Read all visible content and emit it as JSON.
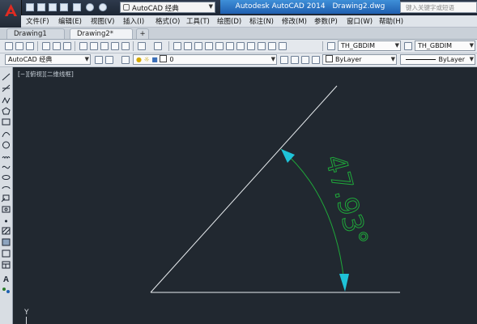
{
  "title_bar": {
    "workspace": "AutoCAD 经典",
    "app_name": "Autodesk AutoCAD 2014",
    "document_name": "Drawing2.dwg",
    "search_placeholder": "键入关键字或短语"
  },
  "menu": {
    "items": [
      "文件(F)",
      "编辑(E)",
      "视图(V)",
      "插入(I)",
      "格式(O)",
      "工具(T)",
      "绘图(D)",
      "标注(N)",
      "修改(M)",
      "参数(P)",
      "窗口(W)",
      "帮助(H)"
    ]
  },
  "tabs": {
    "items": [
      "Drawing1",
      "Drawing2*"
    ],
    "active": "Drawing2*"
  },
  "toolbar1": {
    "text_style": "TH_GBDIM",
    "dim_style": "TH_GBDIM"
  },
  "toolbar2": {
    "workspace": "AutoCAD 经典",
    "layer": "0",
    "color": "ByLayer",
    "linetype": "ByLayer"
  },
  "canvas": {
    "viewport_label": "[−][俯视][二维线框]",
    "ucs_label": "Y",
    "background_color": "#212830",
    "line_color": "#e8ecef",
    "dimension_text": "47.93°",
    "dimension_color": "#1fa83a",
    "arrow_color": "#1fc3d8"
  }
}
